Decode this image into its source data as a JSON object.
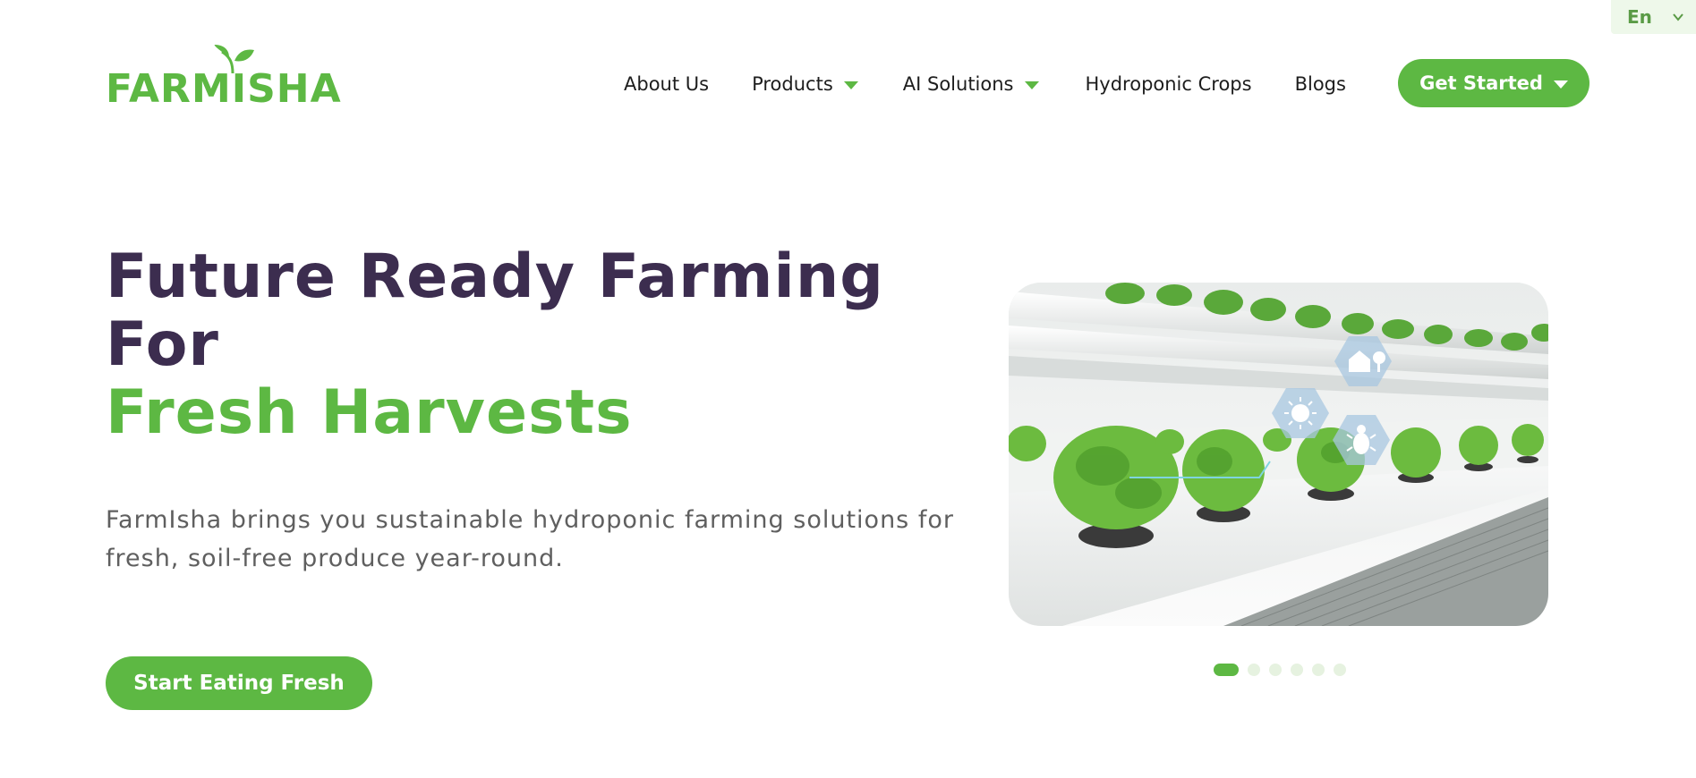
{
  "language": {
    "label": "En",
    "icon": "chevron-down-icon"
  },
  "brand": {
    "name": "FARMISHA",
    "logo_icon": "leaf-icon",
    "primary_color": "#5db843",
    "heading_color": "#3c2d4f"
  },
  "nav": {
    "items": [
      {
        "label": "About Us",
        "has_dropdown": false
      },
      {
        "label": "Products",
        "has_dropdown": true
      },
      {
        "label": "AI Solutions",
        "has_dropdown": true
      },
      {
        "label": "Hydroponic Crops",
        "has_dropdown": false
      },
      {
        "label": "Blogs",
        "has_dropdown": false
      }
    ],
    "cta_label": "Get Started"
  },
  "hero": {
    "title_line1": "Future Ready Farming",
    "title_line2": "For",
    "title_highlight": "Fresh Harvests",
    "description": "FarmIsha brings you sustainable hydroponic farming solutions for fresh, soil-free produce year-round.",
    "cta_label": "Start Eating Fresh",
    "image_icons": [
      "house-tree-icon",
      "sun-icon",
      "bug-icon"
    ]
  },
  "carousel": {
    "total_slides": 6,
    "active_slide": 1
  }
}
